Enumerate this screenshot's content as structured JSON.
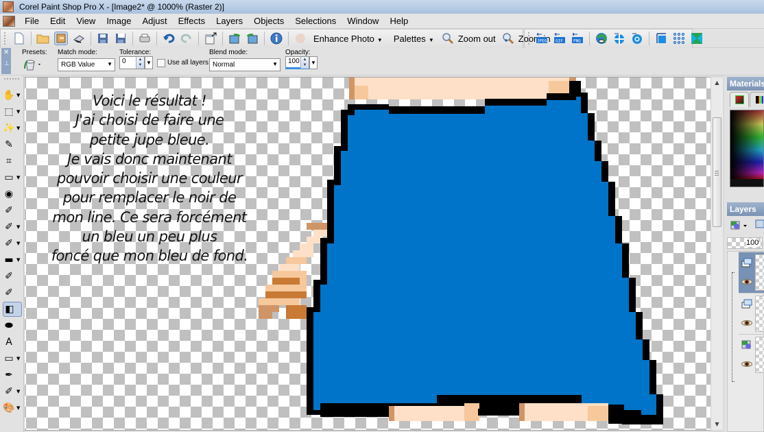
{
  "window": {
    "title": "Corel Paint Shop Pro X - [Image2* @ 1000% (Raster 2)]",
    "app_icon": "paintshop-app-icon"
  },
  "menu": {
    "items": [
      {
        "label": "File",
        "accel": "F"
      },
      {
        "label": "Edit",
        "accel": "E"
      },
      {
        "label": "View",
        "accel": "V"
      },
      {
        "label": "Image",
        "accel": "I"
      },
      {
        "label": "Adjust",
        "accel": "A"
      },
      {
        "label": "Effects",
        "accel": "t"
      },
      {
        "label": "Layers",
        "accel": "L"
      },
      {
        "label": "Objects",
        "accel": "O"
      },
      {
        "label": "Selections",
        "accel": "S"
      },
      {
        "label": "Window",
        "accel": "W"
      },
      {
        "label": "Help",
        "accel": "H"
      }
    ]
  },
  "toolbar": {
    "enhance_photo": "Enhance Photo",
    "palettes": "Palettes",
    "zoom_out": "Zoom out",
    "zoom_in": "Zoom in",
    "export_labels": [
      "JPEG",
      "GIF",
      "PNG"
    ]
  },
  "tool_options": {
    "presets_label": "Presets:",
    "match_mode_label": "Match mode:",
    "match_mode_value": "RGB Value",
    "tolerance_label": "Tolerance:",
    "tolerance_value": "0",
    "use_all_layers_label": "Use all layers",
    "use_all_layers_checked": false,
    "blend_mode_label": "Blend mode:",
    "blend_mode_value": "Normal",
    "opacity_label": "Opacity:",
    "opacity_value": "100"
  },
  "tools": [
    {
      "name": "pan-tool",
      "glyph": "✋",
      "has_menu": true
    },
    {
      "name": "pick-tool",
      "glyph": "⬚",
      "has_menu": true
    },
    {
      "name": "magic-wand-tool",
      "glyph": "✨",
      "has_menu": true
    },
    {
      "name": "dropper-tool",
      "glyph": "✎",
      "has_menu": false
    },
    {
      "name": "crop-tool",
      "glyph": "⌗",
      "has_menu": false
    },
    {
      "name": "perspective-tool",
      "glyph": "▭",
      "has_menu": true
    },
    {
      "name": "red-eye-tool",
      "glyph": "◉",
      "has_menu": false
    },
    {
      "name": "makeover-tool",
      "glyph": "✐",
      "has_menu": false
    },
    {
      "name": "clone-brush-tool",
      "glyph": "✐",
      "has_menu": true
    },
    {
      "name": "paint-brush-tool",
      "glyph": "✐",
      "has_menu": true
    },
    {
      "name": "gradient-tool",
      "glyph": "▬",
      "has_menu": true
    },
    {
      "name": "eraser-tool",
      "glyph": "✐",
      "has_menu": false
    },
    {
      "name": "color-replacer-tool",
      "glyph": "✐",
      "has_menu": false
    },
    {
      "name": "flood-fill-tool",
      "glyph": "◧",
      "has_menu": false,
      "active": true
    },
    {
      "name": "object-eraser-tool",
      "glyph": "⬬",
      "has_menu": false
    },
    {
      "name": "text-tool",
      "glyph": "A",
      "has_menu": false
    },
    {
      "name": "rectangle-tool",
      "glyph": "▭",
      "has_menu": true
    },
    {
      "name": "pen-tool",
      "glyph": "✒",
      "has_menu": false
    },
    {
      "name": "warp-brush-tool",
      "glyph": "✐",
      "has_menu": true
    },
    {
      "name": "art-media-tool",
      "glyph": "🎨",
      "has_menu": true
    }
  ],
  "canvas": {
    "zoom": "1000%",
    "active_layer": "Raster 2",
    "annotation_lines": [
      "Voici le résultat !",
      "J'ai choisi de faire une",
      "petite jupe bleue.",
      "Je vais donc maintenant",
      "pouvoir choisir une couleur",
      "pour remplacer le noir de",
      "mon line. Ce sera forcément",
      "un bleu un peu plus",
      "foncé que mon bleu de fond."
    ],
    "colors": {
      "skirt_fill": "#0074c8",
      "outline": "#000000",
      "skin_light": "#fde0c7",
      "skin_mid": "#f6c89c",
      "skin_shadow": "#d09566",
      "skin_dark": "#c97a35",
      "checker": "#c0c0c0"
    }
  },
  "materials_panel": {
    "title": "Materials"
  },
  "layers_panel": {
    "title": "Layers",
    "opacity": "100",
    "layers": [
      {
        "type": "raster",
        "selected": true,
        "visible": true
      },
      {
        "type": "raster",
        "selected": false,
        "visible": true
      },
      {
        "type": "vector",
        "selected": false,
        "visible": true
      }
    ]
  }
}
